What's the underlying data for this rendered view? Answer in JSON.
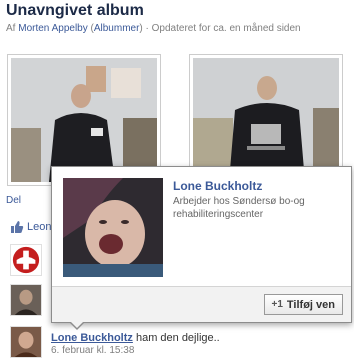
{
  "album": {
    "title": "Unavngivet album",
    "by_prefix": "Af",
    "owner": "Morten Appelby",
    "albums_link": "Albummer",
    "updated": "Opdateret for ca. en måned siden"
  },
  "actions": {
    "share_link": "Del"
  },
  "likes": {
    "name_partial": "Leon"
  },
  "hovercard": {
    "name": "Lone Buckholtz",
    "work": "Arbejder hos Søndersø bo-og rehabiliteringscenter",
    "add_friend_label": "Tilføj ven",
    "add_friend_icon": "+1"
  },
  "comment": {
    "author": "Lone Buckholtz",
    "text": "ham den dejlige..",
    "time": "6. februar kl. 15:38"
  },
  "colors": {
    "link": "#3b5998",
    "title": "#1c2a47",
    "meta": "#808080"
  }
}
